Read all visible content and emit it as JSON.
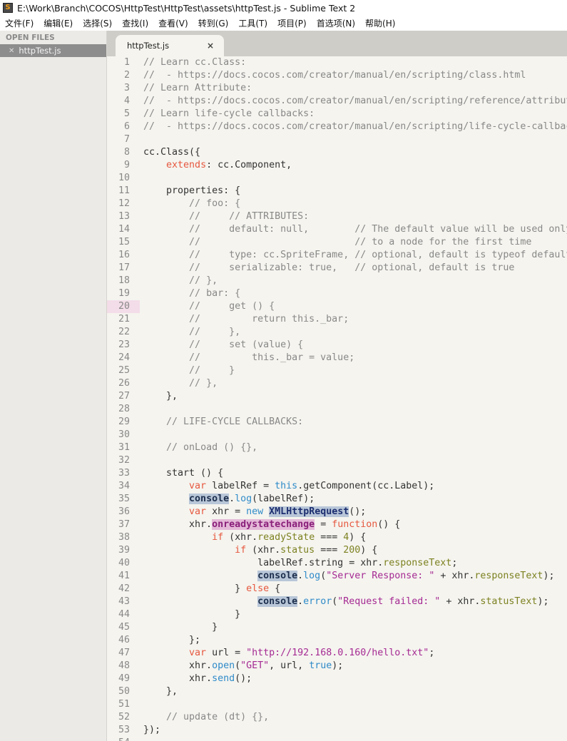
{
  "window": {
    "title": "E:\\Work\\Branch\\COCOS\\HttpTest\\HttpTest\\assets\\httpTest.js - Sublime Text 2",
    "icon": "sublime-icon"
  },
  "menu": [
    "文件(F)",
    "编辑(E)",
    "选择(S)",
    "查找(I)",
    "查看(V)",
    "转到(G)",
    "工具(T)",
    "项目(P)",
    "首选项(N)",
    "帮助(H)"
  ],
  "sidebar": {
    "heading": "OPEN FILES",
    "files": [
      {
        "name": "httpTest.js"
      }
    ]
  },
  "tab": {
    "label": "httpTest.js",
    "close": "×"
  },
  "editor": {
    "current_line": 20,
    "colors": {
      "keyword": "#e6583f",
      "builtin": "#2f8bc9",
      "property": "#7d8221",
      "string": "#a52a93",
      "comment": "#888888"
    },
    "lines": [
      [
        [
          "c",
          "// Learn cc.Class:"
        ]
      ],
      [
        [
          "c",
          "//  - https://docs.cocos.com/creator/manual/en/scripting/class.html"
        ]
      ],
      [
        [
          "c",
          "// Learn Attribute:"
        ]
      ],
      [
        [
          "c",
          "//  - https://docs.cocos.com/creator/manual/en/scripting/reference/attribut"
        ]
      ],
      [
        [
          "c",
          "// Learn life-cycle callbacks:"
        ]
      ],
      [
        [
          "c",
          "//  - https://docs.cocos.com/creator/manual/en/scripting/life-cycle-callbac"
        ]
      ],
      [],
      [
        [
          "",
          "cc.Class({"
        ]
      ],
      [
        [
          "",
          "    "
        ],
        [
          "k",
          "extends"
        ],
        [
          "",
          ": cc.Component,"
        ]
      ],
      [],
      [
        [
          "",
          "    properties: {"
        ]
      ],
      [
        [
          "",
          "        "
        ],
        [
          "c",
          "// foo: {"
        ]
      ],
      [
        [
          "",
          "        "
        ],
        [
          "c",
          "//     // ATTRIBUTES:"
        ]
      ],
      [
        [
          "",
          "        "
        ],
        [
          "c",
          "//     default: null,        // The default value will be used only"
        ]
      ],
      [
        [
          "",
          "        "
        ],
        [
          "c",
          "//                           // to a node for the first time"
        ]
      ],
      [
        [
          "",
          "        "
        ],
        [
          "c",
          "//     type: cc.SpriteFrame, // optional, default is typeof default"
        ]
      ],
      [
        [
          "",
          "        "
        ],
        [
          "c",
          "//     serializable: true,   // optional, default is true"
        ]
      ],
      [
        [
          "",
          "        "
        ],
        [
          "c",
          "// },"
        ]
      ],
      [
        [
          "",
          "        "
        ],
        [
          "c",
          "// bar: {"
        ]
      ],
      [
        [
          "",
          "        "
        ],
        [
          "c",
          "//     get () {"
        ]
      ],
      [
        [
          "",
          "        "
        ],
        [
          "c",
          "//         return this._bar;"
        ]
      ],
      [
        [
          "",
          "        "
        ],
        [
          "c",
          "//     },"
        ]
      ],
      [
        [
          "",
          "        "
        ],
        [
          "c",
          "//     set (value) {"
        ]
      ],
      [
        [
          "",
          "        "
        ],
        [
          "c",
          "//         this._bar = value;"
        ]
      ],
      [
        [
          "",
          "        "
        ],
        [
          "c",
          "//     }"
        ]
      ],
      [
        [
          "",
          "        "
        ],
        [
          "c",
          "// },"
        ]
      ],
      [
        [
          "",
          "    },"
        ]
      ],
      [],
      [
        [
          "",
          "    "
        ],
        [
          "c",
          "// LIFE-CYCLE CALLBACKS:"
        ]
      ],
      [],
      [
        [
          "",
          "    "
        ],
        [
          "c",
          "// onLoad () {},"
        ]
      ],
      [],
      [
        [
          "",
          "    start () {"
        ]
      ],
      [
        [
          "",
          "        "
        ],
        [
          "k",
          "var"
        ],
        [
          "",
          " labelRef = "
        ],
        [
          "b",
          "this"
        ],
        [
          "",
          ".getComponent(cc.Label);"
        ]
      ],
      [
        [
          "",
          "        "
        ],
        [
          "h1",
          "console"
        ],
        [
          "",
          "."
        ],
        [
          "b",
          "log"
        ],
        [
          "",
          "(labelRef);"
        ]
      ],
      [
        [
          "",
          "        "
        ],
        [
          "k",
          "var"
        ],
        [
          "",
          " xhr = "
        ],
        [
          "b",
          "new"
        ],
        [
          "",
          " "
        ],
        [
          "h2",
          "XMLHttpRequest"
        ],
        [
          "",
          "();"
        ]
      ],
      [
        [
          "",
          "        xhr."
        ],
        [
          "h3",
          "onreadystatechange"
        ],
        [
          "",
          " = "
        ],
        [
          "k",
          "function"
        ],
        [
          "",
          "() {"
        ]
      ],
      [
        [
          "",
          "            "
        ],
        [
          "k",
          "if"
        ],
        [
          "",
          " (xhr."
        ],
        [
          "p",
          "readyState"
        ],
        [
          "",
          " === "
        ],
        [
          "n",
          "4"
        ],
        [
          "",
          ") {"
        ]
      ],
      [
        [
          "",
          "                "
        ],
        [
          "k",
          "if"
        ],
        [
          "",
          " (xhr."
        ],
        [
          "p",
          "status"
        ],
        [
          "",
          " === "
        ],
        [
          "n",
          "200"
        ],
        [
          "",
          ") {"
        ]
      ],
      [
        [
          "",
          "                    labelRef.string = xhr."
        ],
        [
          "p",
          "responseText"
        ],
        [
          "",
          ";"
        ]
      ],
      [
        [
          "",
          "                    "
        ],
        [
          "h1",
          "console"
        ],
        [
          "",
          "."
        ],
        [
          "b",
          "log"
        ],
        [
          "",
          "("
        ],
        [
          "s",
          "\"Server Response: \""
        ],
        [
          "",
          " + xhr."
        ],
        [
          "p",
          "responseText"
        ],
        [
          "",
          ");"
        ]
      ],
      [
        [
          "",
          "                } "
        ],
        [
          "k",
          "else"
        ],
        [
          "",
          " {"
        ]
      ],
      [
        [
          "",
          "                    "
        ],
        [
          "h1",
          "console"
        ],
        [
          "",
          "."
        ],
        [
          "b",
          "error"
        ],
        [
          "",
          "("
        ],
        [
          "s",
          "\"Request failed: \""
        ],
        [
          "",
          " + xhr."
        ],
        [
          "p",
          "statusText"
        ],
        [
          "",
          ");"
        ]
      ],
      [
        [
          "",
          "                }"
        ]
      ],
      [
        [
          "",
          "            }"
        ]
      ],
      [
        [
          "",
          "        };"
        ]
      ],
      [
        [
          "",
          "        "
        ],
        [
          "k",
          "var"
        ],
        [
          "",
          " url = "
        ],
        [
          "s",
          "\"http://192.168.0.160/hello.txt\""
        ],
        [
          "",
          ";"
        ]
      ],
      [
        [
          "",
          "        xhr."
        ],
        [
          "b",
          "open"
        ],
        [
          "",
          "("
        ],
        [
          "s",
          "\"GET\""
        ],
        [
          "",
          ", url, "
        ],
        [
          "b",
          "true"
        ],
        [
          "",
          ");"
        ]
      ],
      [
        [
          "",
          "        xhr."
        ],
        [
          "b",
          "send"
        ],
        [
          "",
          "();"
        ]
      ],
      [
        [
          "",
          "    },"
        ]
      ],
      [],
      [
        [
          "",
          "    "
        ],
        [
          "c",
          "// update (dt) {},"
        ]
      ],
      [
        [
          "",
          "});"
        ]
      ],
      []
    ]
  }
}
